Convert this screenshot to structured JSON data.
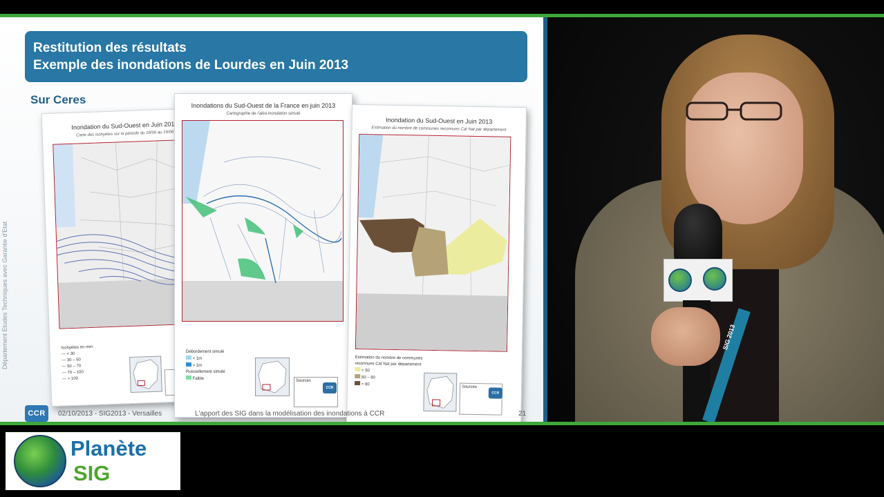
{
  "slide": {
    "title_line_1": "Restitution des résultats",
    "title_line_2": "Exemple des inondations de Lourdes en Juin 2013",
    "subheading": "Sur Ceres",
    "side_text": "Département Etudes Techniques avec Garantie d'Etat",
    "footer": {
      "logo": "CCR",
      "date_event": "02/10/2013 - SIG2013 - Versailles",
      "caption": "L'apport des SIG dans la modélisation des inondations à CCR",
      "page": "21"
    },
    "maps": [
      {
        "title": "Inondation du Sud-Ouest en Juin 2013",
        "subtitle": "Carte des isohyètes sur la période du 18/06 au 19/06",
        "legend_title": "Isohyètes en mm",
        "legend_items": [
          "< 30",
          "30 – 50",
          "50 – 70",
          "70 – 100",
          "> 100"
        ]
      },
      {
        "title": "Inondations du Sud-Ouest de la France en juin 2013",
        "subtitle": "Cartographie de l'aléa inondation simulé",
        "legend_title": "Débordement simulé",
        "legend_items": [
          "< 1m",
          "> 1m"
        ],
        "legend_title_2": "Ruissellement simulé",
        "legend_items_2": [
          "Faible"
        ],
        "source_label": "Sources"
      },
      {
        "title": "Inondation du Sud-Ouest en Juin 2013",
        "subtitle": "Estimation du nombre de communes reconnues Cat Nat par département",
        "legend_title": "Estimation du nombre de communes reconnues Cat Nat par département",
        "legend_items": [
          "< 50",
          "50 – 80",
          "> 80"
        ],
        "source_label": "Sources"
      }
    ]
  },
  "video": {
    "lanyard_text": "SIG 2013"
  },
  "brand": {
    "line_1": "Planète",
    "line_2": "SIG"
  },
  "colors": {
    "accent_green": "#3fa83a",
    "title_blue": "#2877a5",
    "brand_blue": "#1b6fa8",
    "brand_green": "#4fa52f"
  }
}
